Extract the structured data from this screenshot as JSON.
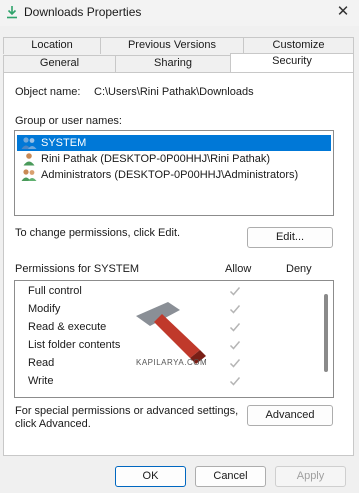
{
  "window": {
    "title": "Downloads Properties",
    "close_glyph": "✕"
  },
  "tabs": {
    "row1": [
      "Location",
      "Previous Versions",
      "Customize"
    ],
    "row2": [
      "General",
      "Sharing",
      "Security"
    ],
    "active": "Security"
  },
  "security": {
    "object_name_label": "Object name:",
    "object_name_value": "C:\\Users\\Rini Pathak\\Downloads",
    "group_label": "Group or user names:",
    "users": [
      {
        "name": "SYSTEM",
        "selected": true,
        "icon": "users-icon"
      },
      {
        "name": "Rini Pathak (DESKTOP-0P00HHJ\\Rini Pathak)",
        "selected": false,
        "icon": "user-icon"
      },
      {
        "name": "Administrators (DESKTOP-0P00HHJ\\Administrators)",
        "selected": false,
        "icon": "users-icon"
      }
    ],
    "change_text": "To change permissions, click Edit.",
    "edit_button": "Edit...",
    "permissions_label": "Permissions for SYSTEM",
    "allow_header": "Allow",
    "deny_header": "Deny",
    "permissions": [
      {
        "name": "Full control",
        "allow": true,
        "deny": false
      },
      {
        "name": "Modify",
        "allow": true,
        "deny": false
      },
      {
        "name": "Read & execute",
        "allow": true,
        "deny": false
      },
      {
        "name": "List folder contents",
        "allow": true,
        "deny": false
      },
      {
        "name": "Read",
        "allow": true,
        "deny": false
      },
      {
        "name": "Write",
        "allow": true,
        "deny": false
      }
    ],
    "special_line1": "For special permissions or advanced settings,",
    "special_line2": "click Advanced.",
    "advanced_button": "Advanced"
  },
  "watermark": {
    "text": "KAPILARYA.COM"
  },
  "footer": {
    "ok": "OK",
    "cancel": "Cancel",
    "apply": "Apply"
  },
  "colors": {
    "selection": "#0078d7",
    "accent_border": "#0067c0",
    "check": "#b5b5b5"
  }
}
